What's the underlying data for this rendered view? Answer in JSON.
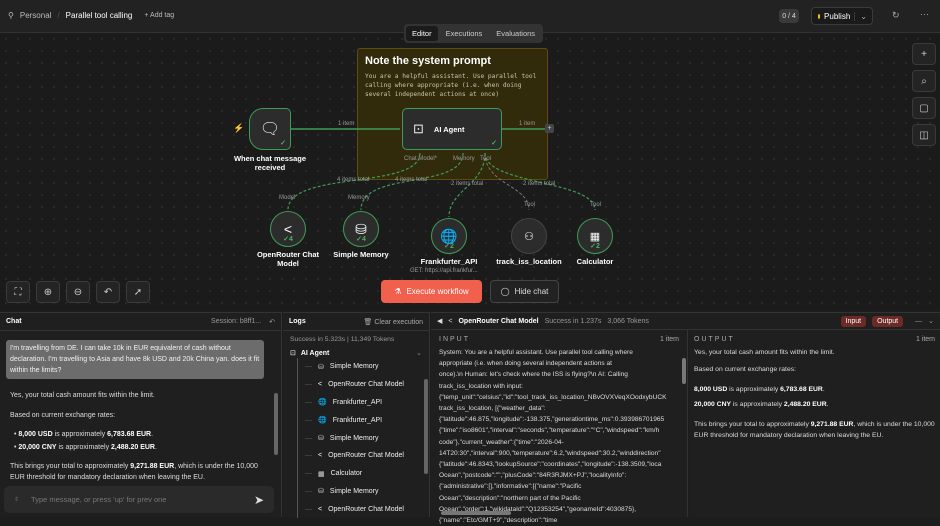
{
  "header": {
    "project": "Personal",
    "workflow": "Parallel tool calling",
    "add_tag": "+ Add tag",
    "counter": "0 / 4",
    "publish": "Publish"
  },
  "tabs": [
    "Editor",
    "Executions",
    "Evaluations"
  ],
  "note": {
    "title": "Note the system prompt",
    "body": "You are a helpful assistant. Use parallel tool calling where appropriate (i.e. when doing several independent actions at once)"
  },
  "nodes": {
    "trigger": {
      "label": "When chat message received"
    },
    "agent": {
      "label": "AI Agent",
      "ports": [
        "Chat Model*",
        "Memory",
        "Tool"
      ]
    },
    "openrouter": {
      "label": "OpenRouter Chat Model",
      "port": "Model",
      "count": "4"
    },
    "memory": {
      "label": "Simple Memory",
      "port": "Memory",
      "count": "4"
    },
    "frankfurter": {
      "label": "Frankfurter_API",
      "sub": "GET: https://api.frankfur...",
      "count": "2"
    },
    "iss": {
      "label": "track_iss_location",
      "port": "Tool"
    },
    "calculator": {
      "label": "Calculator",
      "port": "Tool",
      "count": "2"
    }
  },
  "edges": {
    "in": "1 item",
    "out": "1 item",
    "model": "4 items total",
    "memory": "4 items total",
    "tool1": "2 items total",
    "tool2": "2 items total"
  },
  "canvas_buttons": {
    "execute": "Execute workflow",
    "hide_chat": "Hide chat"
  },
  "chat": {
    "title": "Chat",
    "session": "Session: b8ff1...",
    "user_msg": "I'm travelling from DE. I can take 10k in EUR equivalent of cash without declaration. I'm travelling to Asia and have 8k USD and 20k China yan. does it fit within the limits?",
    "reply": {
      "p1": "Yes, your total cash amount fits within the limit.",
      "p2": "Based on current exchange rates:",
      "b1a": "8,000 USD",
      "b1b": " is approximately ",
      "b1c": "6,783.68 EUR",
      "b1d": ".",
      "b2a": "20,000 CNY",
      "b2b": " is approximately ",
      "b2c": "2,488.20 EUR",
      "b2d": ".",
      "p3a": "This brings your total to approximately ",
      "p3b": "9,271.88 EUR",
      "p3c": ", which is under the 10,000 EUR threshold for mandatory declaration when leaving the EU."
    },
    "placeholder": "Type message, or press 'up' for prev one"
  },
  "logs": {
    "title": "Logs",
    "clear": "Clear execution",
    "status": "Success in 5.323s",
    "tokens": "11,349 Tokens",
    "root": "AI Agent",
    "items": [
      {
        "icon": "db",
        "label": "Simple Memory"
      },
      {
        "icon": "or",
        "label": "OpenRouter Chat Model"
      },
      {
        "icon": "globe",
        "label": "Frankfurter_API"
      },
      {
        "icon": "globe",
        "label": "Frankfurter_API"
      },
      {
        "icon": "db",
        "label": "Simple Memory"
      },
      {
        "icon": "or",
        "label": "OpenRouter Chat Model"
      },
      {
        "icon": "calc",
        "label": "Calculator"
      },
      {
        "icon": "db",
        "label": "Simple Memory"
      },
      {
        "icon": "or",
        "label": "OpenRouter Chat Model"
      }
    ]
  },
  "detail": {
    "title": "OpenRouter Chat Model",
    "status": "Success in 1.237s",
    "tokens": "3,066 Tokens",
    "input_btn": "Input",
    "output_btn": "Output",
    "input": {
      "heading": "INPUT",
      "count": "1 item",
      "lines": [
        "System: You are a helpful assistant. Use parallel tool calling where",
        "appropriate (i.e. when doing several independent actions at",
        "once).\\n Human: let's check where the ISS is flying?\\n AI: Calling",
        "track_iss_location with input:",
        "{\"temp_unit\":\"celsius\",\"id\":\"tool_track_iss_location_NBvOVXVeqXOodxybUCK",
        "track_iss_location, [{\"weather_data\":",
        "{\"latitude\":46.875,\"longitude\":-138.375,\"generationtime_ms\":0.393986701965",
        "{\"time\":\"iso8601\",\"interval\":\"seconds\",\"temperature\":\"°C\",\"windspeed\":\"km/h",
        "code\"},\"current_weather\":{\"time\":\"2026-04-",
        "14T20:30\",\"interval\":900,\"temperature\":6.2,\"windspeed\":30.2,\"winddirection\"",
        "{\"latitude\":46.8343,\"lookupSource\":\"coordinates\",\"longitude\":-138.3509,\"loca",
        "Ocean\",\"postcode\":\"\",\"plusCode\":\"84R3RJMX+PJ\",\"localityInfo\":",
        "{\"administrative\":[],\"informative\":[{\"name\":\"Pacific",
        "Ocean\",\"description\":\"northern part of the Pacific",
        "Ocean\",\"order\":1,\"wikidataId\":\"Q12353254\",\"geonameId\":4030875},",
        "{\"name\":\"Etc/GMT+9\",\"description\":\"time"
      ]
    },
    "output": {
      "heading": "OUTPUT",
      "count": "1 item"
    }
  }
}
